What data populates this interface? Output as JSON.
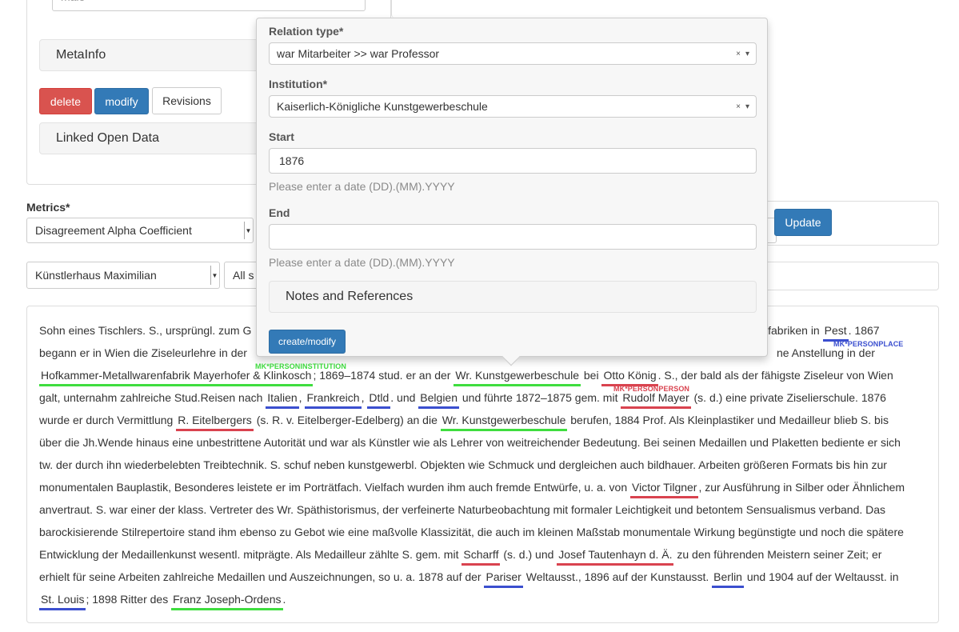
{
  "top_form": {
    "partial_field_value": "male",
    "metainfo_label": "MetaInfo",
    "delete_label": "delete",
    "modify_label": "modify",
    "revisions_label": "Revisions",
    "lod_label": "Linked Open Data"
  },
  "metrics": {
    "label": "Metrics*",
    "selected": "Disagreement Alpha Coefficient",
    "update_label": "Update"
  },
  "filter": {
    "project_selected": "Künstlerhaus Maximilian",
    "second_selected_partial": "All s"
  },
  "popover": {
    "relation_type_label": "Relation type*",
    "relation_type_value": "war Mitarbeiter >> war Professor",
    "institution_label": "Institution*",
    "institution_value": "Kaiserlich-Königliche Kunstgewerbeschule",
    "start_label": "Start",
    "start_value": "1876",
    "start_help": "Please enter a date (DD).(MM).YYYY",
    "end_label": "End",
    "end_value": "",
    "end_help": "Please enter a date (DD).(MM).YYYY",
    "notes_label": "Notes and References",
    "submit_label": "create/modify",
    "clear_glyph": "×",
    "dropdown_glyph": "▾"
  },
  "tags": {
    "person_institution": "MK*PERSONINSTITUTION",
    "person_place": "MK*PERSONPLACE",
    "person_person": "MK*PERSONPERSON"
  },
  "text": {
    "l1_a": "Sohn eines Tischlers. S., ursprüngl. zum G",
    "l1_b": "nfabriken in",
    "l1_pest": "Pest",
    "l1_c": ". 1867",
    "l2_a": "begann er in Wien die Ziseleurlehre in der",
    "l2_b": "ne Anstellung in der",
    "l3_hof": "Hofkammer-Metallwarenfabrik Mayerhofer & Klinkosch",
    "l3_a": "; 1869–1874 stud. er an der",
    "l3_kgs": "Wr. Kunstgewerbeschule",
    "l3_b": "bei",
    "l3_otto": "Otto König",
    "l3_c": ". S., der bald als der fähigste Ziseleur von Wien",
    "l4_a": "galt, unternahm zahlreiche Stud.Reisen nach",
    "l4_italien": "Italien",
    "l4_frankreich": "Frankreich",
    "l4_dtld": "Dtld",
    "l4_b": ". und",
    "l4_belgien": "Belgien",
    "l4_c": "und führte 1872–1875 gem. mit",
    "l4_mayer": "Rudolf Mayer",
    "l4_d": "(s. d.) eine private Ziselierschule. 1876",
    "l5_a": "wurde er durch Vermittlung",
    "l5_eitel": "R. Eitelbergers",
    "l5_b": "(s. R. v. Eitelberger-Edelberg) an die",
    "l5_kgs": "Wr. Kunstgewerbeschule",
    "l5_c": "berufen, 1884 Prof. Als Kleinplastiker und Medailleur blieb S. bis",
    "l6": "über die Jh.Wende hinaus eine unbestrittene Autorität und war als Künstler wie als Lehrer von weitreichender Bedeutung. Bei seinen Medaillen und Plaketten bediente er sich",
    "l7": "tw. der durch ihn wiederbelebten Treibtechnik. S. schuf neben kunstgewerbl. Objekten wie Schmuck und dergleichen auch bildhauer. Arbeiten größeren Formats bis hin zur",
    "l8_a": "monumentalen Bauplastik, Besonderes leistete er im Porträtfach. Vielfach wurden ihm auch fremde Entwürfe, u. a. von",
    "l8_tilgner": "Victor Tilgner",
    "l8_b": ", zur Ausführung in Silber oder Ähnlichem",
    "l9": "anvertraut. S. war einer der klass. Vertreter des Wr. Späthistorismus, der verfeinerte Naturbeobachtung mit formaler Leichtigkeit und betontem Sensualismus verband. Das",
    "l10": "barockisierende Stilrepertoire stand ihm ebenso zu Gebot wie eine maßvolle Klassizität, die auch im kleinen Maßstab monumentale Wirkung begünstigte und noch die spätere",
    "l11_a": "Entwicklung der Medaillenkunst wesentl. mitprägte. Als Medailleur zählte S. gem. mit",
    "l11_scharff": "Scharff",
    "l11_b": "(s. d.) und",
    "l11_taut": "Josef Tautenhayn d. Ä.",
    "l11_c": "zu den führenden Meistern seiner Zeit; er",
    "l12_a": "erhielt für seine Arbeiten zahlreiche Medaillen und Auszeichnungen, so u. a. 1878 auf der",
    "l12_pariser": "Pariser",
    "l12_b": "Weltausst., 1896 auf der Kunstausst.",
    "l12_berlin": "Berlin",
    "l12_c": "und 1904 auf der Weltausst. in",
    "l13_stlouis": "St. Louis",
    "l13_a": "; 1898 Ritter des",
    "l13_fj": "Franz Joseph-Ordens",
    "l13_b": "."
  }
}
